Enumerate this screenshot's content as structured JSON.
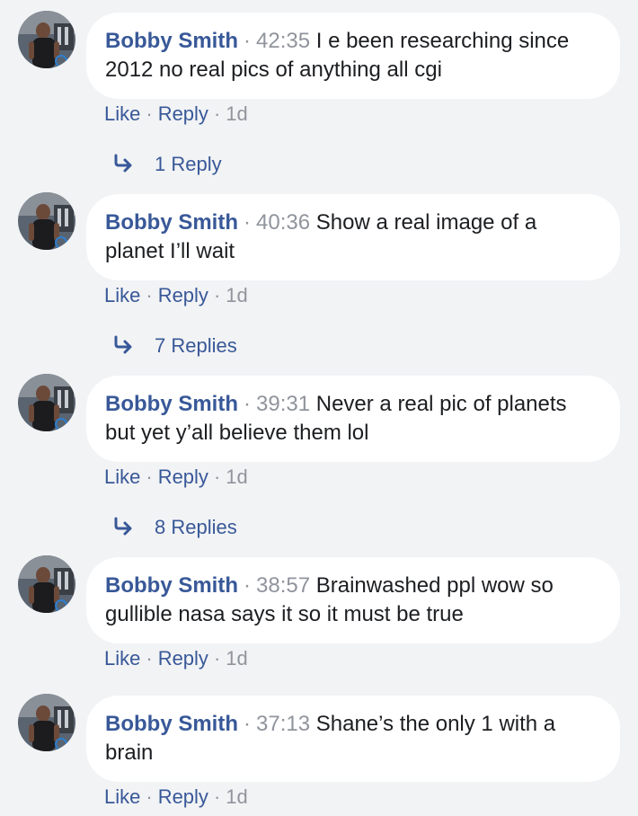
{
  "colors": {
    "background": "#f2f3f5",
    "bubble": "#ffffff",
    "author_link": "#385898",
    "meta_gray": "#90949c",
    "body_text": "#1c1e21"
  },
  "comments": [
    {
      "author": "Bobby Smith",
      "separator": "·",
      "timestamp": "42:35",
      "text": "I e been researching since 2012 no real pics of anything all cgi",
      "like_label": "Like",
      "reply_label": "Reply",
      "age": "1d",
      "replies_label": "1 Reply",
      "reply_icon": "reply-arrow-icon"
    },
    {
      "author": "Bobby Smith",
      "separator": "·",
      "timestamp": "40:36",
      "text": "Show a real image of a planet I’ll wait",
      "like_label": "Like",
      "reply_label": "Reply",
      "age": "1d",
      "replies_label": "7 Replies",
      "reply_icon": "reply-arrow-icon"
    },
    {
      "author": "Bobby Smith",
      "separator": "·",
      "timestamp": "39:31",
      "text": "Never a real pic of planets but yet y’all believe them lol",
      "like_label": "Like",
      "reply_label": "Reply",
      "age": "1d",
      "replies_label": "8 Replies",
      "reply_icon": "reply-arrow-icon"
    },
    {
      "author": "Bobby Smith",
      "separator": "·",
      "timestamp": "38:57",
      "text": "Brainwashed ppl wow so gullible nasa says it so it must be true",
      "like_label": "Like",
      "reply_label": "Reply",
      "age": "1d"
    },
    {
      "author": "Bobby Smith",
      "separator": "·",
      "timestamp": "37:13",
      "text": "Shane’s the only 1 with a brain",
      "like_label": "Like",
      "reply_label": "Reply",
      "age": "1d"
    }
  ]
}
